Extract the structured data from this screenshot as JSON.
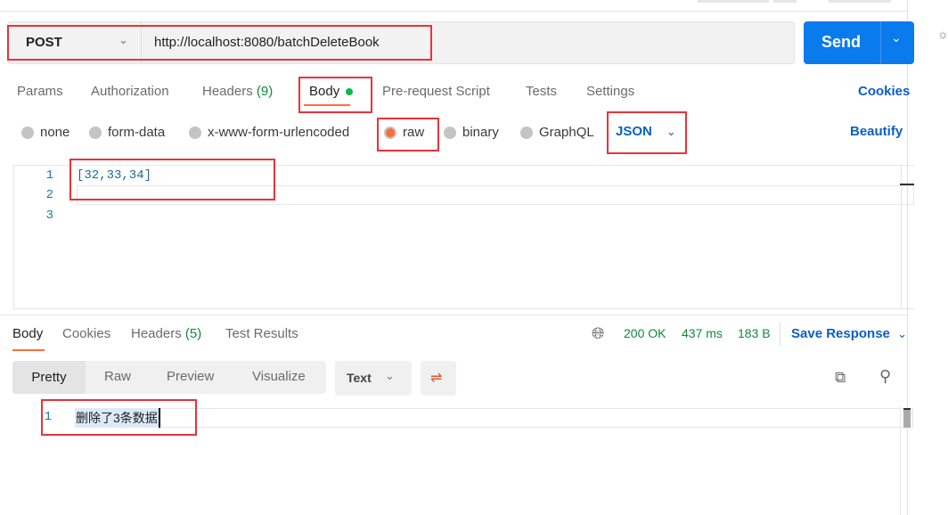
{
  "request": {
    "method": "POST",
    "url": "http://localhost:8080/batchDeleteBook",
    "send_label": "Send"
  },
  "tabs": [
    {
      "label": "Params"
    },
    {
      "label": "Authorization"
    },
    {
      "label": "Headers",
      "count": "(9)"
    },
    {
      "label": "Body",
      "active": true
    },
    {
      "label": "Pre-request Script"
    },
    {
      "label": "Tests"
    },
    {
      "label": "Settings"
    }
  ],
  "cookies_link": "Cookies",
  "body_types": [
    {
      "label": "none"
    },
    {
      "label": "form-data"
    },
    {
      "label": "x-www-form-urlencoded"
    },
    {
      "label": "raw",
      "selected": true
    },
    {
      "label": "binary"
    },
    {
      "label": "GraphQL"
    }
  ],
  "format": "JSON",
  "beautify": "Beautify",
  "editor": {
    "lines": [
      "1",
      "2",
      "3"
    ],
    "code": "[32,33,34]"
  },
  "response": {
    "tabs": [
      {
        "label": "Body"
      },
      {
        "label": "Cookies"
      },
      {
        "label": "Headers",
        "count": "(5)"
      },
      {
        "label": "Test Results"
      }
    ],
    "status": "200 OK",
    "time": "437 ms",
    "size": "183 B",
    "save": "Save Response",
    "views": [
      "Pretty",
      "Raw",
      "Preview",
      "Visualize"
    ],
    "type": "Text",
    "line": "1",
    "text": "删除了3条数据"
  },
  "colors": {
    "accent": "#ff6c37",
    "send": "#097bed",
    "link": "#0b5fc6",
    "status": "#0e8a3b"
  }
}
